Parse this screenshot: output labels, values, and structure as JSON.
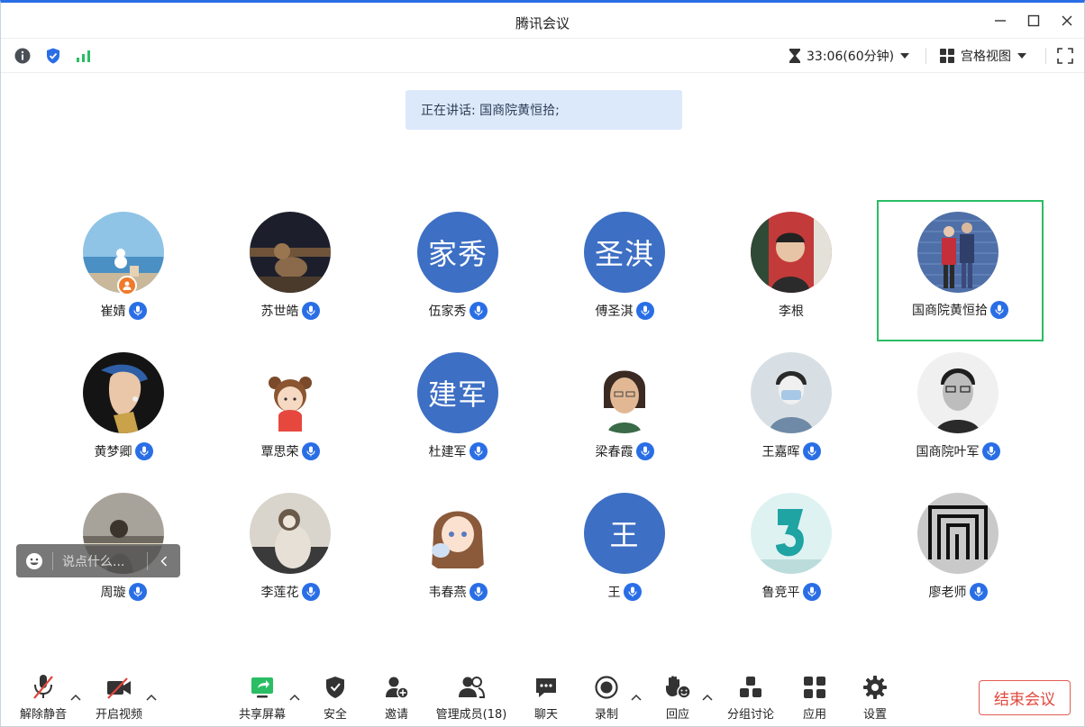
{
  "window": {
    "title": "腾讯会议"
  },
  "status": {
    "timer": "33:06(60分钟)",
    "view_mode": "宫格视图"
  },
  "speaking": {
    "text": "正在讲话: 国商院黄恒拾;"
  },
  "participants": [
    {
      "name": "崔婧"
    },
    {
      "name": "苏世皓"
    },
    {
      "name": "伍家秀",
      "avatar_text": "家秀"
    },
    {
      "name": "傅圣淇",
      "avatar_text": "圣淇"
    },
    {
      "name": "李根"
    },
    {
      "name": "国商院黄恒拾"
    },
    {
      "name": "黄梦卿"
    },
    {
      "name": "覃思荣"
    },
    {
      "name": "杜建军",
      "avatar_text": "建军"
    },
    {
      "name": "梁春霞"
    },
    {
      "name": "王嘉晖"
    },
    {
      "name": "国商院叶军"
    },
    {
      "name": "周璇"
    },
    {
      "name": "李莲花"
    },
    {
      "name": "韦春燕"
    },
    {
      "name": "王",
      "avatar_text": "王"
    },
    {
      "name": "鲁竞平"
    },
    {
      "name": "廖老师"
    }
  ],
  "chat": {
    "placeholder": "说点什么..."
  },
  "toolbar": {
    "unmute": "解除静音",
    "video": "开启视频",
    "share": "共享屏幕",
    "security": "安全",
    "invite": "邀请",
    "members": "管理成员(18)",
    "chat": "聊天",
    "record": "录制",
    "react": "回应",
    "breakout": "分组讨论",
    "apps": "应用",
    "settings": "设置",
    "end": "结束会议"
  },
  "colors": {
    "accent": "#2a6ee6",
    "avatar_bg": "#3d6fc4",
    "active_border": "#2bbd64",
    "signal": "#2bbd64",
    "end_button": "#e0463c",
    "banner_bg": "#dce9fb"
  },
  "icons": {
    "info": "info-icon",
    "security": "shield-check-icon",
    "signal": "signal-bars-icon",
    "timer": "hourglass-icon",
    "grid": "grid-view-icon",
    "fullscreen": "fullscreen-icon",
    "mic": "mic-icon",
    "host": "host-badge-icon"
  }
}
